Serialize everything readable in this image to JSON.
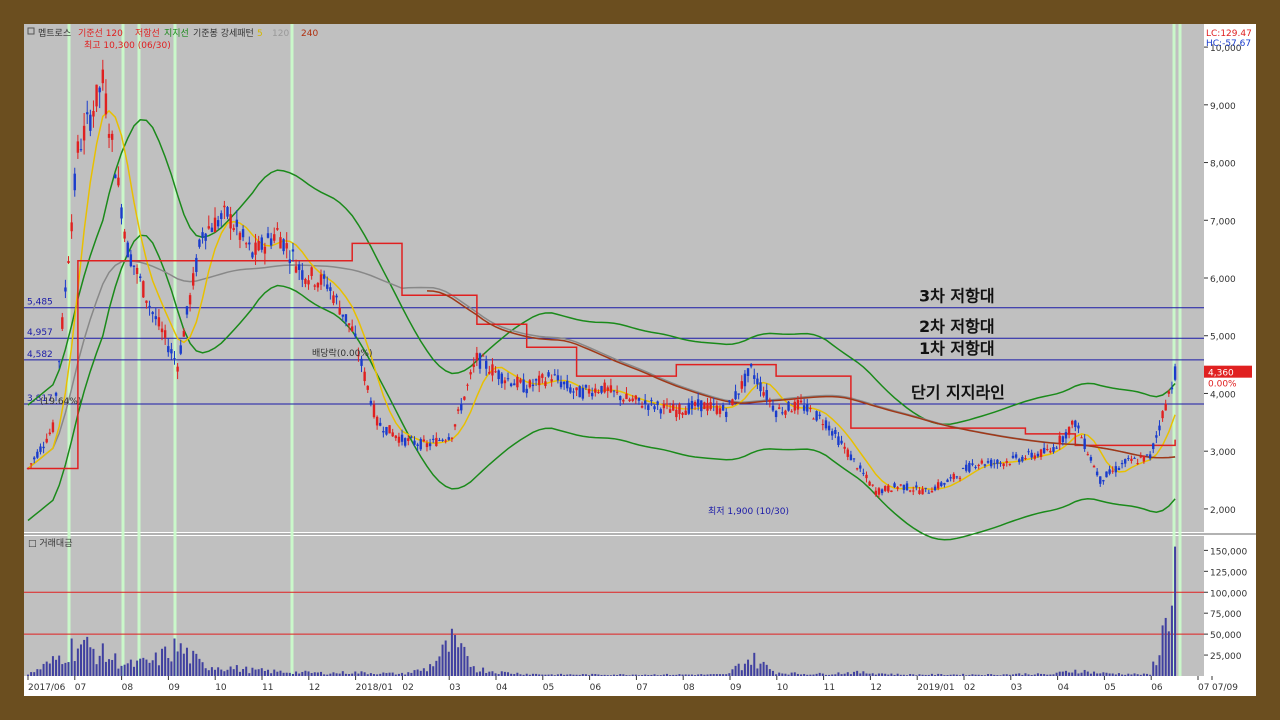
{
  "header": {
    "stock_name": "멥트로스",
    "items": [
      {
        "label": "기준선 120",
        "color": "#e02020"
      },
      {
        "label": "저항선",
        "color": "#e02020"
      },
      {
        "label": "지지선",
        "color": "#1a8a1a"
      },
      {
        "label": "기준봉 강세패턴",
        "color": "#333333"
      },
      {
        "label": "5",
        "color": "#d4b800"
      },
      {
        "label": "120",
        "color": "#999999"
      },
      {
        "label": "240",
        "color": "#b03010"
      }
    ],
    "lc": "LC:129.47",
    "hc": "HC:-57.67"
  },
  "annotations": {
    "high": "최고 10,300 (06/30)",
    "low": "최저 1,900 (10/30)",
    "mid_label": "배당락(0.00%)",
    "pct_label": "(19.64%)",
    "current_price": "4,360",
    "current_pct": "0.00%"
  },
  "levels": [
    {
      "value": 5485,
      "label": "5,485",
      "text": "3차 저항대"
    },
    {
      "value": 4957,
      "label": "4,957",
      "text": "2차 저항대"
    },
    {
      "value": 4582,
      "label": "4,582",
      "text": "1차 저항대"
    },
    {
      "value": 3817,
      "label": "3,817",
      "text": "단기 지지라인"
    }
  ],
  "volume": {
    "title": "거래대금",
    "y_ticks": [
      "150,000",
      "125,000",
      "100,000",
      "75,000",
      "50,000",
      "25,000"
    ],
    "ref_lines": [
      100000,
      50000
    ]
  },
  "chart_data": {
    "type": "candlestick",
    "price_ticks": [
      "10,000",
      "9,000",
      "8,000",
      "7,000",
      "6,000",
      "5,000",
      "4,000",
      "3,000",
      "2,000"
    ],
    "ylim": [
      1600,
      10400
    ],
    "x_labels": [
      "2017/06",
      "07",
      "08",
      "09",
      "10",
      "11",
      "12",
      "2018/01",
      "02",
      "03",
      "04",
      "05",
      "06",
      "07",
      "08",
      "09",
      "10",
      "11",
      "12",
      "2019/01",
      "02",
      "03",
      "04",
      "05",
      "06",
      "07",
      "07/09"
    ],
    "price_path": [
      [
        0,
        2700
      ],
      [
        2,
        3400
      ],
      [
        4,
        8200
      ],
      [
        6,
        9400
      ],
      [
        8,
        6500
      ],
      [
        10,
        5400
      ],
      [
        12,
        4500
      ],
      [
        14,
        6800
      ],
      [
        16,
        7100
      ],
      [
        18,
        6400
      ],
      [
        20,
        6800
      ],
      [
        22,
        6100
      ],
      [
        24,
        5900
      ],
      [
        26,
        5100
      ],
      [
        28,
        3500
      ],
      [
        30,
        3200
      ],
      [
        32,
        3100
      ],
      [
        34,
        3300
      ],
      [
        36,
        4600
      ],
      [
        38,
        4300
      ],
      [
        40,
        4100
      ],
      [
        42,
        4300
      ],
      [
        44,
        4000
      ],
      [
        46,
        4100
      ],
      [
        48,
        3900
      ],
      [
        50,
        3800
      ],
      [
        52,
        3700
      ],
      [
        54,
        3800
      ],
      [
        56,
        3700
      ],
      [
        58,
        4400
      ],
      [
        60,
        3700
      ],
      [
        62,
        3800
      ],
      [
        64,
        3500
      ],
      [
        66,
        2900
      ],
      [
        68,
        2300
      ],
      [
        70,
        2400
      ],
      [
        72,
        2300
      ],
      [
        74,
        2500
      ],
      [
        76,
        2800
      ],
      [
        78,
        2800
      ],
      [
        80,
        2900
      ],
      [
        82,
        3000
      ],
      [
        84,
        3500
      ],
      [
        86,
        2500
      ],
      [
        88,
        2800
      ],
      [
        90,
        2900
      ],
      [
        92,
        4360
      ]
    ],
    "volume_path": [
      [
        0,
        2000
      ],
      [
        2,
        20000
      ],
      [
        4,
        45000
      ],
      [
        6,
        30000
      ],
      [
        8,
        15000
      ],
      [
        10,
        20000
      ],
      [
        12,
        40000
      ],
      [
        14,
        15000
      ],
      [
        16,
        12000
      ],
      [
        18,
        8000
      ],
      [
        20,
        6000
      ],
      [
        22,
        5000
      ],
      [
        24,
        4000
      ],
      [
        26,
        5000
      ],
      [
        28,
        4000
      ],
      [
        30,
        3000
      ],
      [
        32,
        10000
      ],
      [
        34,
        45000
      ],
      [
        36,
        10000
      ],
      [
        38,
        5000
      ],
      [
        40,
        3000
      ],
      [
        42,
        2000
      ],
      [
        44,
        2000
      ],
      [
        46,
        2000
      ],
      [
        48,
        2000
      ],
      [
        50,
        2000
      ],
      [
        52,
        2000
      ],
      [
        54,
        2000
      ],
      [
        56,
        2000
      ],
      [
        58,
        25000
      ],
      [
        60,
        5000
      ],
      [
        62,
        3000
      ],
      [
        64,
        3000
      ],
      [
        66,
        5000
      ],
      [
        68,
        4000
      ],
      [
        70,
        2000
      ],
      [
        72,
        2000
      ],
      [
        74,
        2000
      ],
      [
        76,
        2000
      ],
      [
        78,
        2000
      ],
      [
        80,
        3000
      ],
      [
        82,
        2000
      ],
      [
        84,
        8000
      ],
      [
        86,
        4000
      ],
      [
        88,
        3000
      ],
      [
        90,
        2000
      ],
      [
        91,
        55000
      ],
      [
        92,
        150000
      ]
    ]
  }
}
